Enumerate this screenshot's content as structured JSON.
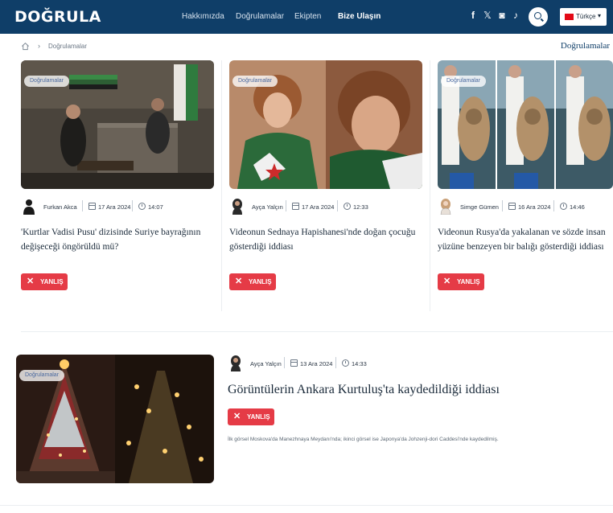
{
  "header": {
    "logo": "DOĞRULA",
    "nav": [
      "Hakkımızda",
      "Doğrulamalar",
      "Ekipten",
      "Bize Ulaşın"
    ],
    "social_icons": [
      "facebook-icon",
      "x-icon",
      "instagram-icon",
      "tiktok-icon"
    ],
    "social_glyphs": [
      "f",
      "𝕏",
      "◙",
      "♪"
    ],
    "language": "Türkçe",
    "chevron": "▾"
  },
  "breadcrumb": {
    "separator": "›",
    "current": "Doğrulamalar",
    "section_title": "Doğrulamalar"
  },
  "articles": [
    {
      "category": "Doğrulamalar",
      "author": "Furkan Akca",
      "date": "17 Ara 2024",
      "time": "14:07",
      "title": "'Kurtlar Vadisi Pusu' dizisinde Suriye bayrağının değişeceği öngörüldü mü?",
      "verdict": "YANLIŞ"
    },
    {
      "category": "Doğrulamalar",
      "author": "Ayça Yalçın",
      "date": "17 Ara 2024",
      "time": "12:33",
      "title": "Videonun Sednaya Hapishanesi'nde doğan çocuğu gösterdiği iddiası",
      "verdict": "YANLIŞ"
    },
    {
      "category": "Doğrulamalar",
      "author": "Simge Gümen",
      "date": "16 Ara 2024",
      "time": "14:46",
      "title": "Videonun Rusya'da yakalanan ve sözde insan yüzüne benzeyen bir balığı gösterdiği iddiası",
      "verdict": "YANLIŞ"
    }
  ],
  "featured": {
    "category": "Doğrulamalar",
    "author": "Ayça Yalçın",
    "date": "13 Ara 2024",
    "time": "14:33",
    "title": "Görüntülerin Ankara Kurtuluş'ta kaydedildiği iddiası",
    "verdict": "YANLIŞ",
    "description": "İlk görsel Moskova'da Manezhnaya Meydanı'nda; ikinci görsel ise Japonya'da Johzenji-dori Caddesi'nde kaydedilmiş."
  },
  "icons": {
    "close": "✕"
  },
  "colors": {
    "header_bg": "#0f3e68",
    "verdict_red": "#e53b46",
    "tag_text": "#4b6aa0"
  }
}
